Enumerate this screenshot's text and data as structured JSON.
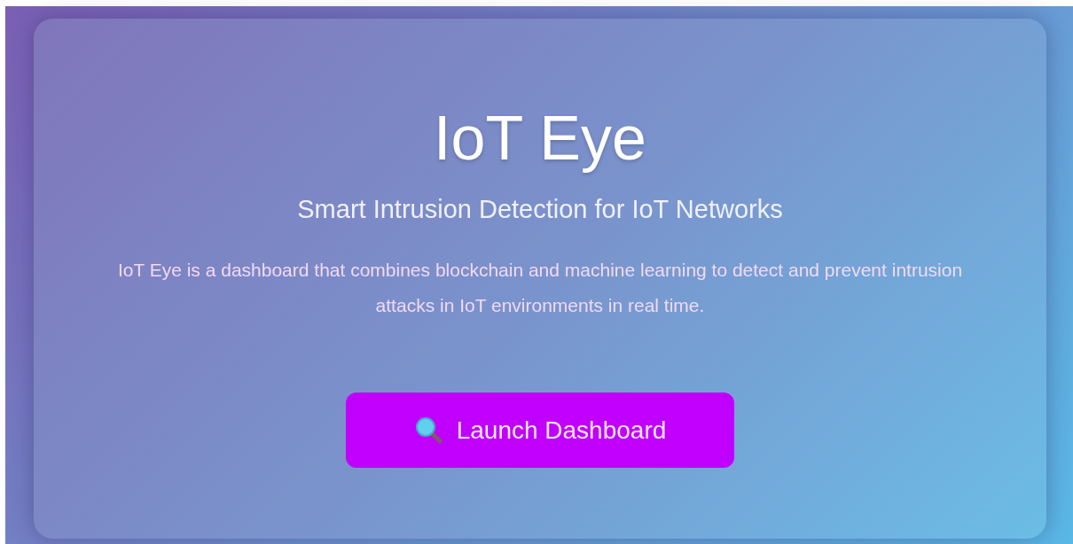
{
  "hero": {
    "title": "IoT Eye",
    "subtitle": "Smart Intrusion Detection for IoT Networks",
    "description": "IoT Eye is a dashboard that combines blockchain and machine learning to detect and prevent intrusion attacks in IoT environments in real time.",
    "button": {
      "label": "Launch Dashboard"
    }
  }
}
